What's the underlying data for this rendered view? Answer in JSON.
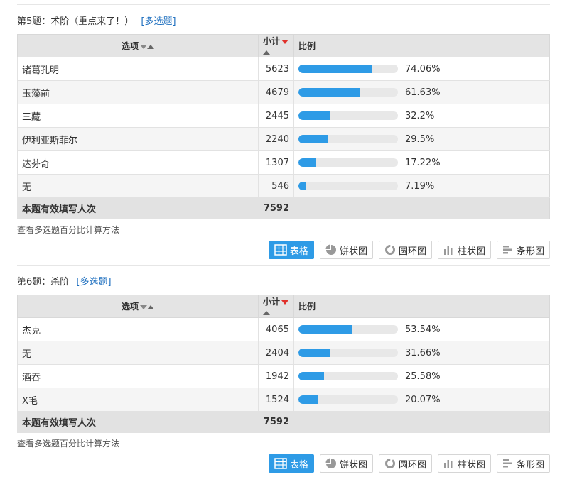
{
  "questions": [
    {
      "title": "第5题：术阶（重点来了！）",
      "tag": "[多选题]",
      "headers": {
        "option": "选项",
        "count": "小计",
        "ratio": "比例"
      },
      "rows": [
        {
          "option": "诸葛孔明",
          "count": "5623",
          "pct": "74.06%",
          "fill": 74.06
        },
        {
          "option": "玉藻前",
          "count": "4679",
          "pct": "61.63%",
          "fill": 61.63
        },
        {
          "option": "三藏",
          "count": "2445",
          "pct": "32.2%",
          "fill": 32.2
        },
        {
          "option": "伊利亚斯菲尔",
          "count": "2240",
          "pct": "29.5%",
          "fill": 29.5
        },
        {
          "option": "达芬奇",
          "count": "1307",
          "pct": "17.22%",
          "fill": 17.22
        },
        {
          "option": "无",
          "count": "546",
          "pct": "7.19%",
          "fill": 7.19
        }
      ],
      "total_label": "本题有效填写人次",
      "total_value": "7592",
      "calc_link": "查看多选题百分比计算方法",
      "buttons": {
        "table": "表格",
        "pie": "饼状图",
        "ring": "圆环图",
        "column": "柱状图",
        "bar": "条形图"
      }
    },
    {
      "title": "第6题：杀阶",
      "tag": "[多选题]",
      "headers": {
        "option": "选项",
        "count": "小计",
        "ratio": "比例"
      },
      "rows": [
        {
          "option": "杰克",
          "count": "4065",
          "pct": "53.54%",
          "fill": 53.54
        },
        {
          "option": "无",
          "count": "2404",
          "pct": "31.66%",
          "fill": 31.66
        },
        {
          "option": "酒吞",
          "count": "1942",
          "pct": "25.58%",
          "fill": 25.58
        },
        {
          "option": "X毛",
          "count": "1524",
          "pct": "20.07%",
          "fill": 20.07
        }
      ],
      "total_label": "本题有效填写人次",
      "total_value": "7592",
      "calc_link": "查看多选题百分比计算方法",
      "buttons": {
        "table": "表格",
        "pie": "饼状图",
        "ring": "圆环图",
        "column": "柱状图",
        "bar": "条形图"
      }
    }
  ],
  "colors": {
    "accent": "#2e9be6",
    "link": "#1e6fbf",
    "sort_active": "#e0312b"
  }
}
